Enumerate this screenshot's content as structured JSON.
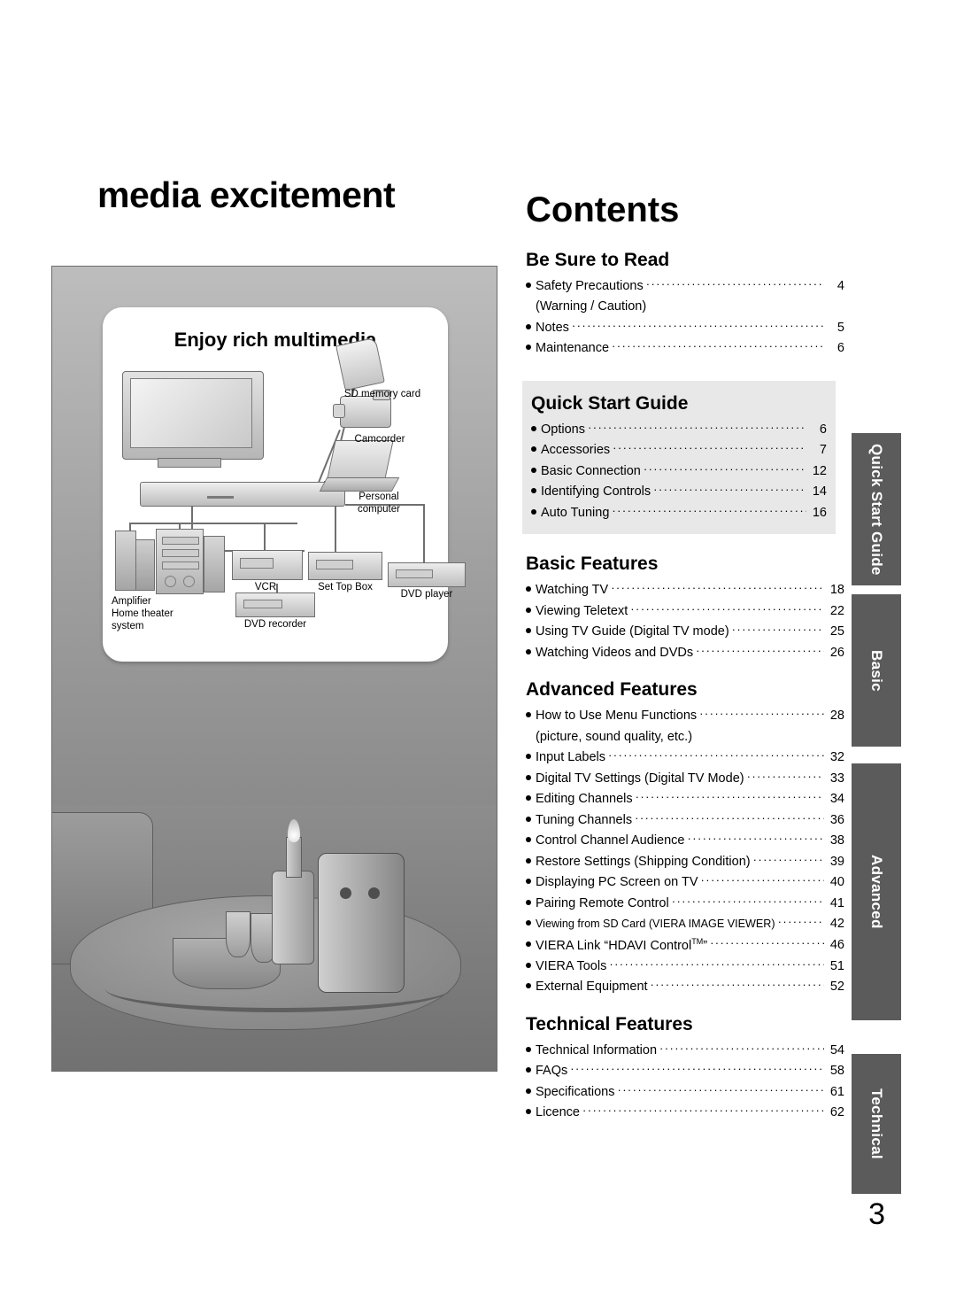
{
  "left": {
    "title": "media excitement",
    "card_heading": "Enjoy rich multimedia",
    "device_labels": {
      "sd": "SD memory card",
      "camcorder": "Camcorder",
      "pc_line1": "Personal",
      "pc_line2": "computer",
      "vcr": "VCR",
      "stb": "Set Top Box",
      "dvd_player": "DVD player",
      "amplifier_line1": "Amplifier",
      "amplifier_line2": "Home theater",
      "amplifier_line3": "system",
      "dvd_recorder": "DVD recorder"
    }
  },
  "contents": {
    "title": "Contents",
    "sections": [
      {
        "name": "be-sure-to-read",
        "title": "Be Sure to Read",
        "shaded": false,
        "items": [
          {
            "label": "Safety Precautions",
            "page": "4"
          },
          {
            "label": "(Warning / Caution)",
            "page": "",
            "sub": true
          },
          {
            "label": "Notes",
            "page": "5"
          },
          {
            "label": "Maintenance",
            "page": "6"
          }
        ]
      },
      {
        "name": "quick-start-guide",
        "title": "Quick Start Guide",
        "shaded": true,
        "items": [
          {
            "label": "Options",
            "page": "6"
          },
          {
            "label": "Accessories",
            "page": "7"
          },
          {
            "label": "Basic Connection",
            "page": "12"
          },
          {
            "label": "Identifying Controls",
            "page": "14"
          },
          {
            "label": "Auto Tuning",
            "page": "16"
          }
        ]
      },
      {
        "name": "basic-features",
        "title": "Basic Features",
        "shaded": false,
        "items": [
          {
            "label": "Watching TV",
            "page": "18"
          },
          {
            "label": "Viewing Teletext",
            "page": "22"
          },
          {
            "label": "Using TV Guide (Digital TV mode)",
            "page": "25"
          },
          {
            "label": "Watching Videos and DVDs",
            "page": "26"
          }
        ]
      },
      {
        "name": "advanced-features",
        "title": "Advanced Features",
        "shaded": false,
        "items": [
          {
            "label": "How to Use Menu Functions",
            "page": "28"
          },
          {
            "label": "(picture, sound quality, etc.)",
            "page": "",
            "sub": true
          },
          {
            "label": "Input Labels",
            "page": "32"
          },
          {
            "label": "Digital TV Settings (Digital TV Mode)",
            "page": "33"
          },
          {
            "label": "Editing Channels",
            "page": "34"
          },
          {
            "label": "Tuning Channels",
            "page": "36"
          },
          {
            "label": "Control Channel Audience",
            "page": "38"
          },
          {
            "label": "Restore Settings (Shipping Condition)",
            "page": "39"
          },
          {
            "label": "Displaying PC Screen on TV",
            "page": "40"
          },
          {
            "label": "Pairing Remote Control",
            "page": "41"
          },
          {
            "label": "Viewing from SD Card (VIERA IMAGE VIEWER)",
            "page": "42",
            "tiny": true
          },
          {
            "label": "VIERA Link “HDAVI Control™”",
            "page": "46"
          },
          {
            "label": "VIERA Tools",
            "page": "51"
          },
          {
            "label": "External Equipment",
            "page": "52"
          }
        ]
      },
      {
        "name": "technical-features",
        "title": "Technical Features",
        "shaded": false,
        "items": [
          {
            "label": "Technical Information",
            "page": "54"
          },
          {
            "label": "FAQs",
            "page": "58"
          },
          {
            "label": "Specifications",
            "page": "61"
          },
          {
            "label": "Licence",
            "page": "62"
          }
        ]
      }
    ]
  },
  "tabs": [
    {
      "name": "quick-start-guide",
      "label": "Quick Start Guide"
    },
    {
      "name": "basic",
      "label": "Basic"
    },
    {
      "name": "advanced",
      "label": "Advanced"
    },
    {
      "name": "technical",
      "label": "Technical"
    }
  ],
  "page_number": "3"
}
